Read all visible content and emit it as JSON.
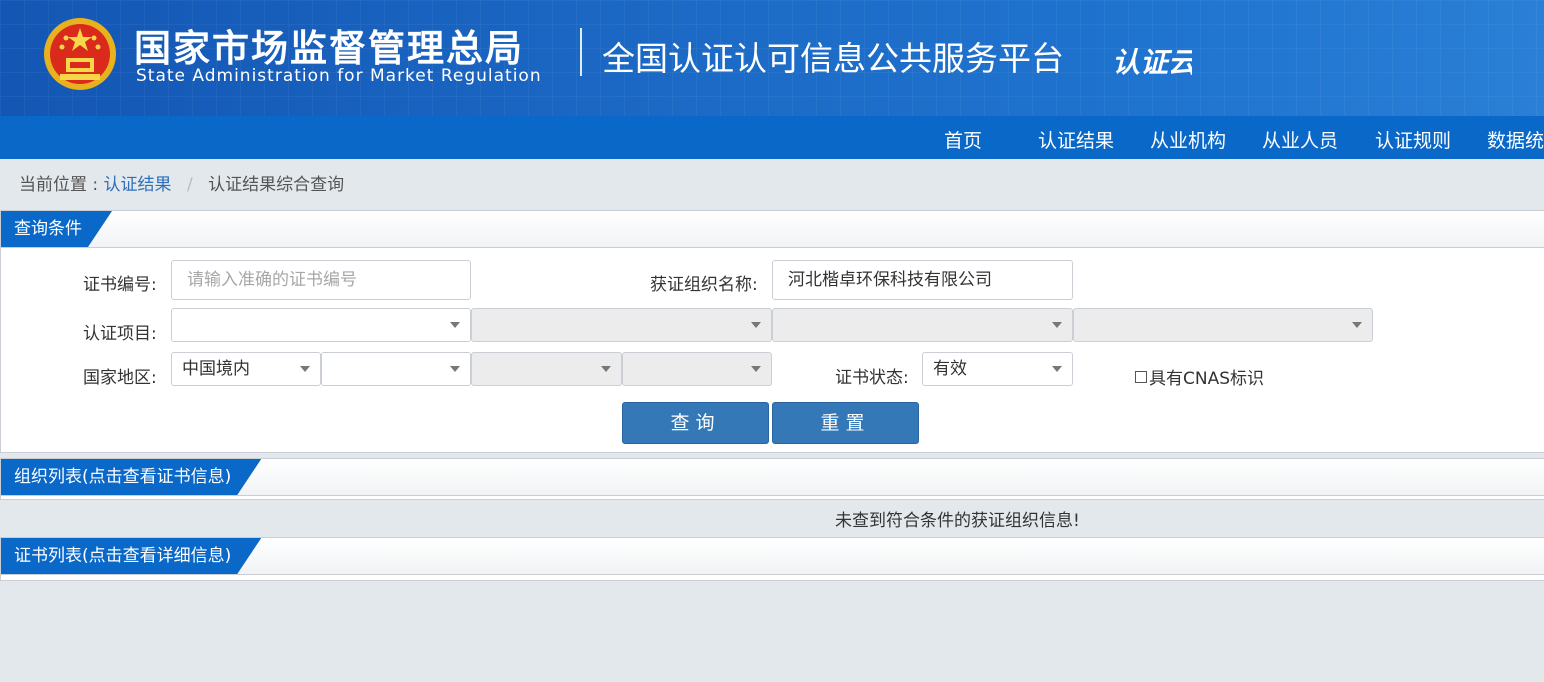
{
  "header": {
    "org_cn": "国家市场监督管理总局",
    "org_en": "State Administration  for  Market Regulation",
    "platform": "全国认证认可信息公共服务平台",
    "logo_text": "认证云"
  },
  "nav": {
    "items": [
      {
        "label": "首页"
      },
      {
        "label": "认证结果"
      },
      {
        "label": "从业机构"
      },
      {
        "label": "从业人员"
      },
      {
        "label": "认证规则"
      },
      {
        "label": "数据统"
      }
    ]
  },
  "breadcrumb": {
    "prefix": "当前位置 :",
    "link": "认证结果",
    "separator": "/",
    "current": "认证结果综合查询"
  },
  "query": {
    "title": "查询条件",
    "cert_no_label": "证书编号:",
    "cert_no_placeholder": "请输入准确的证书编号",
    "org_name_label": "获证组织名称:",
    "org_name_value": "河北楷卓环保科技有限公司",
    "project_label": "认证项目:",
    "region_label": "国家地区:",
    "region_value": "中国境内",
    "status_label": "证书状态:",
    "status_value": "有效",
    "cnas_label": "具有CNAS标识",
    "search_btn": "查询",
    "reset_btn": "重置"
  },
  "org_list": {
    "title": "组织列表(点击查看证书信息)",
    "empty_message": "未查到符合条件的获证组织信息!"
  },
  "cert_list": {
    "title": "证书列表(点击查看详细信息)"
  },
  "colors": {
    "brand_blue": "#0a68c8",
    "button_blue": "#3478b8",
    "header_blue": "#1c6ac6",
    "page_bg": "#e3e8ec"
  }
}
